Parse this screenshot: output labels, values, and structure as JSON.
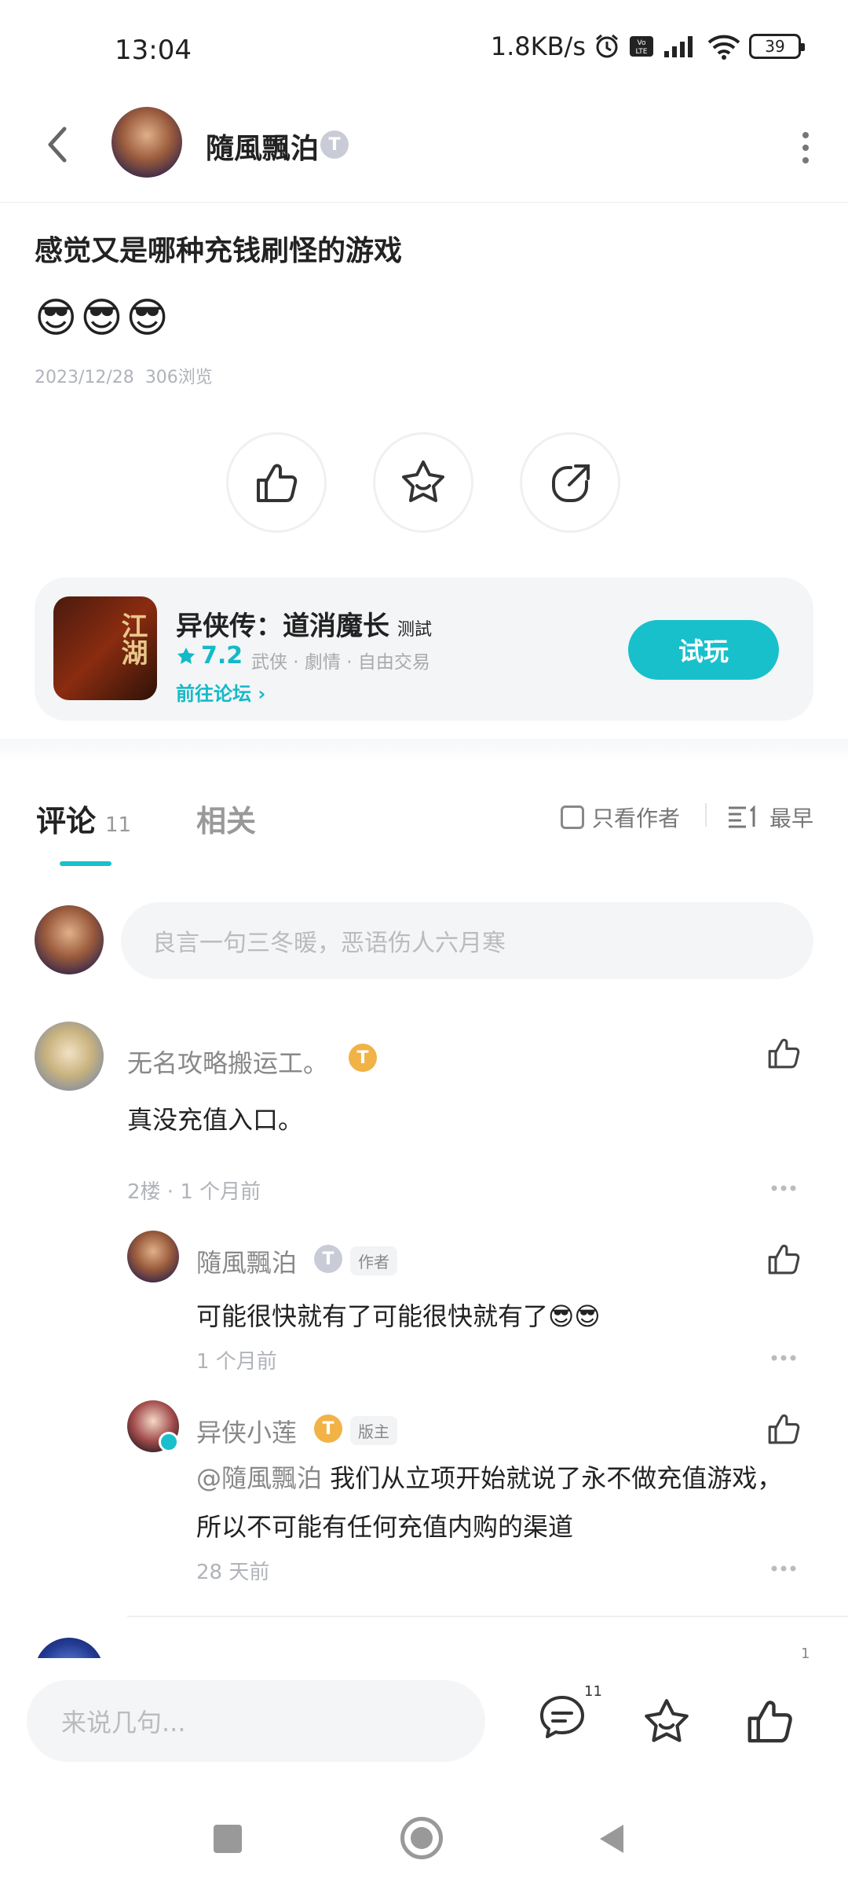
{
  "status_bar": {
    "time": "13:04",
    "net_speed": "1.8KB/s",
    "battery": "39"
  },
  "header": {
    "author_name": "隨風飄泊",
    "author_level": "T"
  },
  "post": {
    "title": "感觉又是哪种充钱刷怪的游戏",
    "emojis": "😎😎😎",
    "date": "2023/12/28",
    "views": "306浏览"
  },
  "game_card": {
    "name": "异侠传：道消魔长",
    "badge": "测試",
    "rating": "7.2",
    "tags": "武侠 · 劇情 · 自由交易",
    "forum_link": "前往论坛",
    "play_label": "试玩",
    "icon_text": "江湖"
  },
  "tabs": {
    "comments_label": "评论",
    "comments_count": "11",
    "related_label": "相关",
    "only_author": "只看作者",
    "sort": "最早"
  },
  "comment_input_placeholder": "良言一句三冬暖，恶语伤人六月寒",
  "comments": [
    {
      "name": "无名攻略搬运工。",
      "level": "T",
      "text": "真没充值入口。",
      "meta": "2楼 · 1 个月前"
    }
  ],
  "replies": [
    {
      "name": "隨風飄泊",
      "level": "T",
      "badge": "作者",
      "text": "可能很快就有了可能很快就有了😎😎",
      "meta": "1 个月前"
    },
    {
      "name": "异侠小莲",
      "level": "T",
      "badge": "版主",
      "mention": "@隨風飄泊",
      "text_line1": " 我们从立项开始就说了永不做充值游戏，",
      "text_line2": "所以不可能有任何充值内购的渠道",
      "meta": "28 天前"
    }
  ],
  "partial_count": "1",
  "bottom_bar": {
    "reply_placeholder": "来说几句...",
    "comment_count": "11"
  }
}
